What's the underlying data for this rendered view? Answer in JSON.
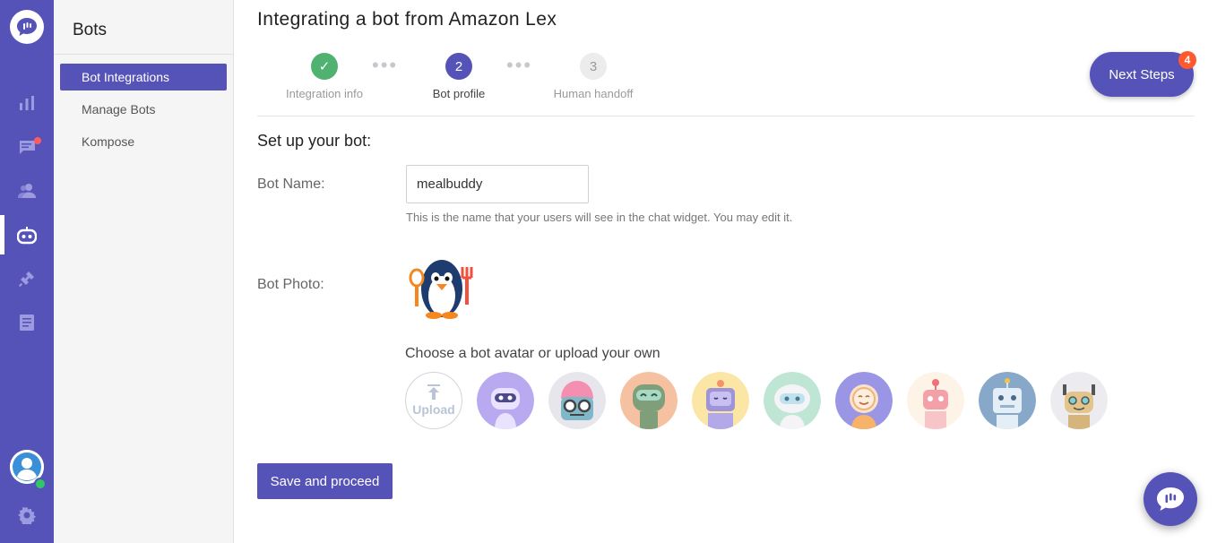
{
  "rail": {
    "items": [
      {
        "name": "reports-icon"
      },
      {
        "name": "conversations-icon"
      },
      {
        "name": "users-icon"
      },
      {
        "name": "bots-icon",
        "active": true
      },
      {
        "name": "integrations-icon"
      },
      {
        "name": "faq-icon"
      }
    ],
    "colors": {
      "background": "#5553b7",
      "unread": "#ff5a5f",
      "online": "#2ec866"
    }
  },
  "sidebar": {
    "title": "Bots",
    "items": [
      {
        "label": "Bot Integrations",
        "active": true
      },
      {
        "label": "Manage Bots"
      },
      {
        "label": "Kompose"
      }
    ]
  },
  "header": {
    "title": "Integrating a bot from Amazon Lex",
    "next_steps_label": "Next Steps",
    "next_steps_count": "4"
  },
  "steps": [
    {
      "number": "✓",
      "label": "Integration info",
      "state": "done"
    },
    {
      "number": "2",
      "label": "Bot profile",
      "state": "current"
    },
    {
      "number": "3",
      "label": "Human handoff",
      "state": "future"
    }
  ],
  "form": {
    "section_title": "Set up your bot:",
    "bot_name_label": "Bot Name:",
    "bot_name_value": "mealbuddy",
    "bot_name_hint": "This is the name that your users will see in the chat widget. You may edit it.",
    "bot_photo_label": "Bot Photo:",
    "choose_label": "Choose a bot avatar or upload your own",
    "upload_label": "Upload",
    "avatars": [
      {
        "name": "avatar-robot-purple",
        "bg": "#b9a9f0"
      },
      {
        "name": "avatar-robot-brain",
        "bg": "#e6e6ec"
      },
      {
        "name": "avatar-robot-green",
        "bg": "#f6c1a0"
      },
      {
        "name": "avatar-robot-lilac",
        "bg": "#fbe6a6"
      },
      {
        "name": "avatar-robot-mint",
        "bg": "#bfe6d4"
      },
      {
        "name": "avatar-robot-smile",
        "bg": "#9b95e6"
      },
      {
        "name": "avatar-robot-pink",
        "bg": "#fdf3e6"
      },
      {
        "name": "avatar-robot-blue",
        "bg": "#87a8c8"
      },
      {
        "name": "avatar-robot-tan",
        "bg": "#ececf0"
      }
    ],
    "save_label": "Save and proceed"
  }
}
